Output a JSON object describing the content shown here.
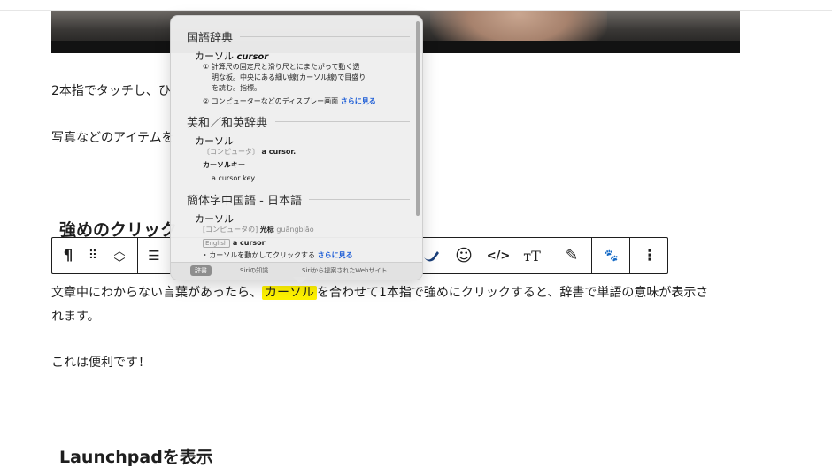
{
  "content": {
    "line1_visible": "2本指でタッチし、ひ",
    "line2_visible": "写真などのアイテムを",
    "heading1_visible": "強めのクリック",
    "para_before": "文章中にわからない言葉があったら、",
    "para_highlight": "カーソル",
    "para_after": "を合わせて1本指で強めにクリックすると、辞書で単語の意味が表示さ",
    "para_wrap": "れます。",
    "para3": "これは便利です！",
    "heading2": "Launchpadを表示"
  },
  "toolbar": {
    "paragraph_glyph": "¶",
    "drag_glyph": "⠿",
    "moveup_glyph": "︿",
    "movedown_glyph": "﹀",
    "align_glyph": "☰",
    "emoji_glyph": "☺",
    "code_glyph": "</>",
    "textsize_glyph": "тT",
    "marker_glyph": "✎",
    "paw_glyph": "🐾",
    "more_glyph": "⋮"
  },
  "popover": {
    "section1": {
      "title": "国語辞典",
      "word": "カーソル",
      "word_en": "cursor",
      "def1a": "① 計算尺の固定尺と滑り尺とにまたがって動く透",
      "def1b": "明な板。中央にある細い線(カーソル線)で目盛り",
      "def1c": "を読む。指標。",
      "def2": "② コンピューターなどのディスプレー画面",
      "more": "さらに見る"
    },
    "section2": {
      "title": "英和／和英辞典",
      "word": "カーソル",
      "note": "〔コンピュータ〕",
      "trans": "a cursor.",
      "sub": "カーソルキー",
      "subtrans": "a cursor key."
    },
    "section3": {
      "title": "簡体字中国語 - 日本語",
      "word": "カーソル",
      "note": "[コンピュータの]",
      "hanzi": "光标",
      "pinyin": "guāngbiāo",
      "tag": "English",
      "english": "a cursor",
      "example": "‣ カーソルを動かしてクリックする",
      "more": "さらに見る"
    },
    "tabs": [
      "辞書",
      "Siriの知識",
      "Siriから提案されたWebサイト"
    ]
  }
}
